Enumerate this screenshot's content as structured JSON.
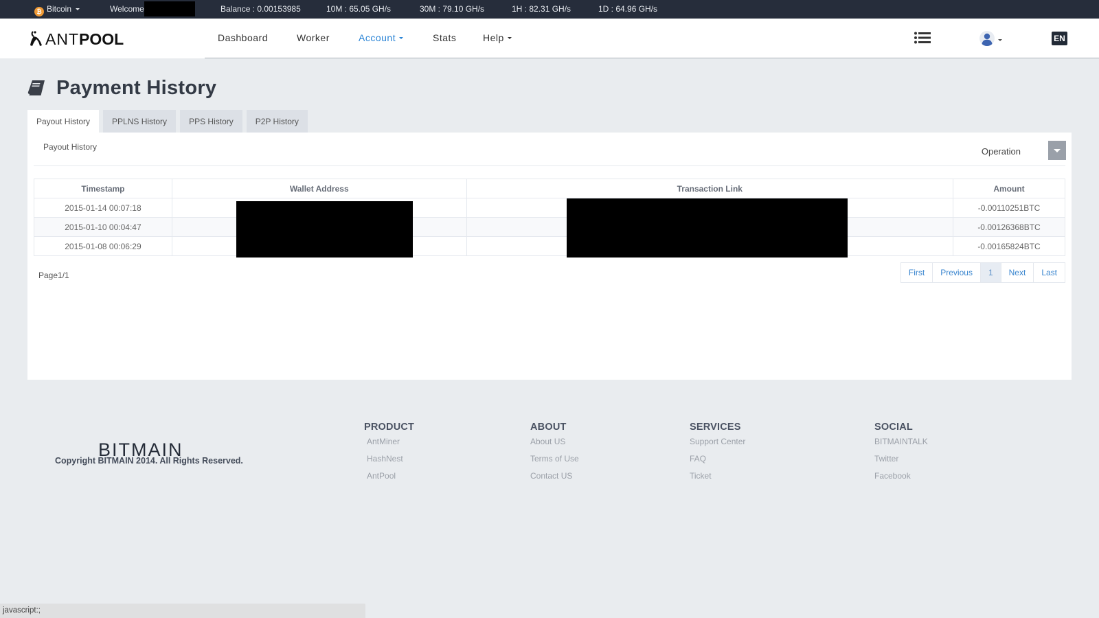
{
  "topbar": {
    "coin": "Bitcoin",
    "coin_icon": "bitcoin-icon",
    "welcome": "Welcome",
    "balance": "Balance : 0.00153985",
    "hashrates": {
      "m10": "10M : 65.05 GH/s",
      "m30": "30M : 79.10 GH/s",
      "h1": "1H : 82.31 GH/s",
      "d1": "1D : 64.96 GH/s"
    }
  },
  "brand": {
    "ant": "ANT",
    "pool": "POOL"
  },
  "nav": {
    "items": [
      {
        "label": "Dashboard"
      },
      {
        "label": "Worker"
      },
      {
        "label": "Account",
        "active": true,
        "dropdown": true
      },
      {
        "label": "Stats"
      },
      {
        "label": "Help",
        "dropdown": true
      }
    ],
    "right_icons": [
      "list-icon",
      "user-avatar-icon"
    ],
    "language": "EN"
  },
  "page": {
    "title": "Payment History",
    "title_icon": "book-icon"
  },
  "tabs": [
    {
      "label": "Payout History",
      "active": true
    },
    {
      "label": "PPLNS History"
    },
    {
      "label": "PPS History"
    },
    {
      "label": "P2P History"
    }
  ],
  "panel": {
    "heading": "Payout History",
    "operation_label": "Operation"
  },
  "table": {
    "columns": [
      "Timestamp",
      "Wallet Address",
      "Transaction Link",
      "Amount"
    ],
    "rows": [
      {
        "timestamp": "2015-01-14 00:07:18",
        "wallet": "",
        "tx": "",
        "amount": "-0.00110251BTC"
      },
      {
        "timestamp": "2015-01-10 00:04:47",
        "wallet": "",
        "tx": "",
        "amount": "-0.00126368BTC"
      },
      {
        "timestamp": "2015-01-08 00:06:29",
        "wallet": "",
        "tx": "",
        "amount": "-0.00165824BTC"
      }
    ]
  },
  "pagination": {
    "info": "Page1/1",
    "first": "First",
    "previous": "Previous",
    "current": "1",
    "next": "Next",
    "last": "Last"
  },
  "footer": {
    "logo": "BITMAIN",
    "copyright": "Copyright BITMAIN 2014. All Rights Reserved.",
    "columns": [
      {
        "title": "PRODUCT",
        "links": [
          "AntMiner",
          "HashNest",
          "AntPool"
        ]
      },
      {
        "title": "ABOUT",
        "links": [
          "About US",
          "Terms of Use",
          "Contact US"
        ]
      },
      {
        "title": "SERVICES",
        "links": [
          "Support Center",
          "FAQ",
          "Ticket"
        ]
      },
      {
        "title": "SOCIAL",
        "links": [
          "BITMAINTALK",
          "Twitter",
          "Facebook"
        ]
      }
    ]
  },
  "statusbar": {
    "text": "javascript:;"
  },
  "colors": {
    "topbar_bg": "#262d3b",
    "accent": "#2a84d6",
    "page_bg": "#e9ecef",
    "bitcoin": "#f09a35",
    "operation_btn": "#9aa0a9"
  }
}
